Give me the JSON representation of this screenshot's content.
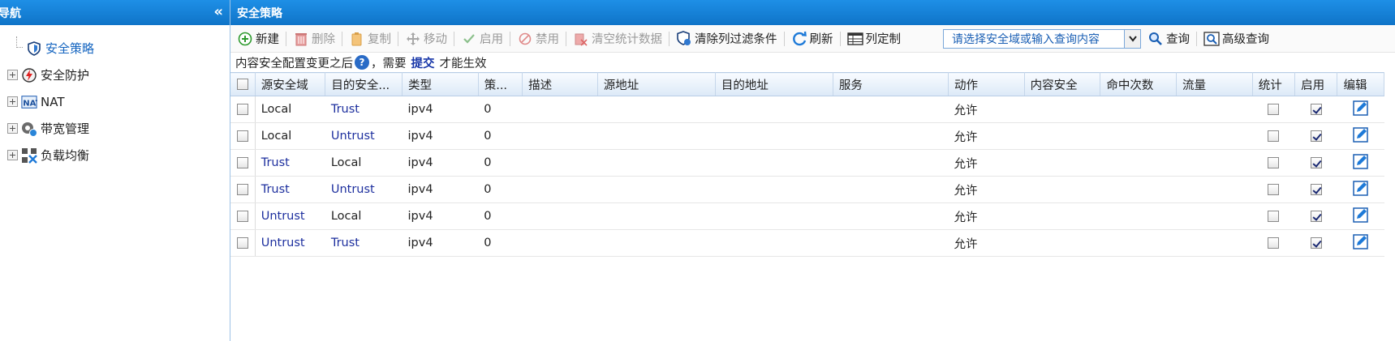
{
  "sidebar": {
    "title": "导航",
    "collapse_glyph": "«",
    "items": [
      {
        "label": "安全策略",
        "icon": "shield-icon",
        "child": true
      },
      {
        "label": "安全防护",
        "icon": "lightning-shield-icon",
        "child": false
      },
      {
        "label": "NAT",
        "icon": "nat-icon",
        "child": false
      },
      {
        "label": "带宽管理",
        "icon": "bandwidth-icon",
        "child": false
      },
      {
        "label": "负载均衡",
        "icon": "load-balance-icon",
        "child": false
      }
    ]
  },
  "main": {
    "title": "安全策略",
    "toolbar": {
      "new": "新建",
      "delete": "删除",
      "copy": "复制",
      "move": "移动",
      "enable": "启用",
      "disable": "禁用",
      "clear_stats": "清空统计数据",
      "clear_filters": "清除列过滤条件",
      "refresh": "刷新",
      "columns": "列定制",
      "search_placeholder": "请选择安全域或输入查询内容",
      "query": "查询",
      "advanced_query": "高级查询"
    },
    "notice": {
      "before": "内容安全配置变更之后",
      "help": "?",
      "mid": "，需要",
      "commit": "提交",
      "after": "才能生效"
    },
    "columns": [
      "源安全域",
      "目的安全...",
      "类型",
      "策...",
      "描述",
      "源地址",
      "目的地址",
      "服务",
      "动作",
      "内容安全",
      "命中次数",
      "流量",
      "统计",
      "启用",
      "编辑"
    ],
    "rows": [
      {
        "src": "Local",
        "dst": "Trust",
        "type": "ipv4",
        "policy": "0",
        "action": "允许",
        "stat": false,
        "enabled": true
      },
      {
        "src": "Local",
        "dst": "Untrust",
        "type": "ipv4",
        "policy": "0",
        "action": "允许",
        "stat": false,
        "enabled": true
      },
      {
        "src": "Trust",
        "dst": "Local",
        "type": "ipv4",
        "policy": "0",
        "action": "允许",
        "stat": false,
        "enabled": true
      },
      {
        "src": "Trust",
        "dst": "Untrust",
        "type": "ipv4",
        "policy": "0",
        "action": "允许",
        "stat": false,
        "enabled": true
      },
      {
        "src": "Untrust",
        "dst": "Local",
        "type": "ipv4",
        "policy": "0",
        "action": "允许",
        "stat": false,
        "enabled": true
      },
      {
        "src": "Untrust",
        "dst": "Trust",
        "type": "ipv4",
        "policy": "0",
        "action": "允许",
        "stat": false,
        "enabled": true
      }
    ]
  },
  "colors": {
    "header_blue": "#0f74c8",
    "link_blue": "#1d2f9e",
    "tree_active": "#1565c0"
  }
}
